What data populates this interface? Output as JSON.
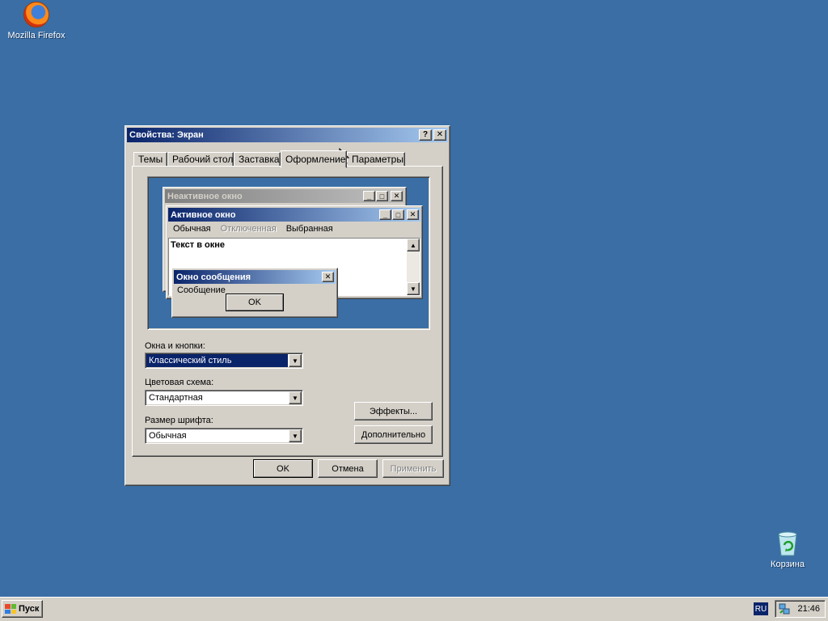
{
  "desktop": {
    "icons": [
      {
        "label": "Mozilla Firefox",
        "icon": "firefox-icon"
      },
      {
        "label": "Корзина",
        "icon": "recycle-bin-icon"
      }
    ],
    "background_color": "#3a6ea5"
  },
  "dialog": {
    "title": "Свойства: Экран",
    "help_glyph": "?",
    "close_glyph": "✕",
    "tabs": [
      {
        "label": "Темы"
      },
      {
        "label": "Рабочий стол"
      },
      {
        "label": "Заставка"
      },
      {
        "label": "Оформление",
        "active": true
      },
      {
        "label": "Параметры"
      }
    ],
    "preview": {
      "inactive_title": "Неактивное окно",
      "active_title": "Активное окно",
      "menu": {
        "normal": "Обычная",
        "disabled": "Отключенная",
        "selected": "Выбранная"
      },
      "window_text": "Текст в окне",
      "message_title": "Окно сообщения",
      "message_text": "Сообщение",
      "ok_label": "OK"
    },
    "fields": {
      "windows_buttons": {
        "label": "Окна и кнопки:",
        "value": "Классический стиль"
      },
      "color_scheme": {
        "label": "Цветовая схема:",
        "value": "Стандартная"
      },
      "font_size": {
        "label": "Размер шрифта:",
        "value": "Обычная"
      }
    },
    "buttons": {
      "effects": "Эффекты...",
      "advanced": "Дополнительно",
      "ok": "OK",
      "cancel": "Отмена",
      "apply": "Применить"
    }
  },
  "taskbar": {
    "start_label": "Пуск",
    "language": "RU",
    "clock": "21:46"
  },
  "colors": {
    "title_active_start": "#0a246a",
    "title_active_end": "#a6caf0",
    "face": "#d4d0c8"
  }
}
